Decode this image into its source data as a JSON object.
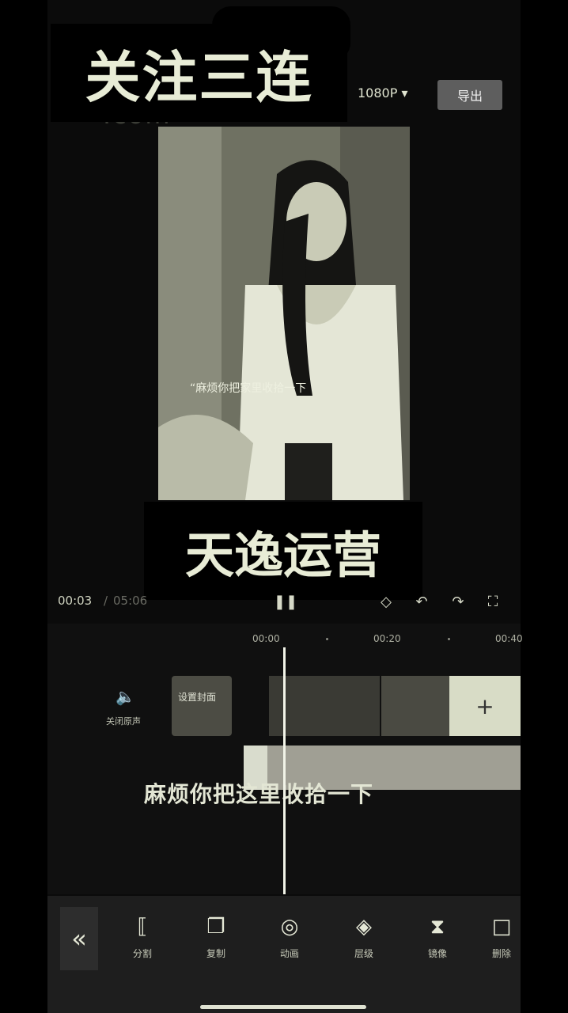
{
  "overlays": {
    "top_caption": "关注三连",
    "bottom_caption": "天逸运营",
    "watermark": ".com"
  },
  "header": {
    "resolution": "1080P",
    "export_label": "导出"
  },
  "preview": {
    "caption": "“麻烦你把家里收拾一下"
  },
  "playback": {
    "current_time": "00:03",
    "separator": "/",
    "total_time": "05:06"
  },
  "timeline": {
    "ticks": [
      "00:00",
      "00:20",
      "00:40"
    ],
    "mute_label": "关闭原声",
    "cover_label": "设置封面",
    "subtitle_clip_text": "麻烦你把这里收拾一下",
    "add_symbol": "+"
  },
  "toolbar": {
    "items": [
      {
        "label": "分割",
        "icon": "split-icon"
      },
      {
        "label": "复制",
        "icon": "copy-icon"
      },
      {
        "label": "动画",
        "icon": "animation-icon"
      },
      {
        "label": "层级",
        "icon": "layers-icon"
      },
      {
        "label": "镜像",
        "icon": "mirror-icon"
      },
      {
        "label": "删除",
        "icon": "delete-icon"
      }
    ]
  }
}
